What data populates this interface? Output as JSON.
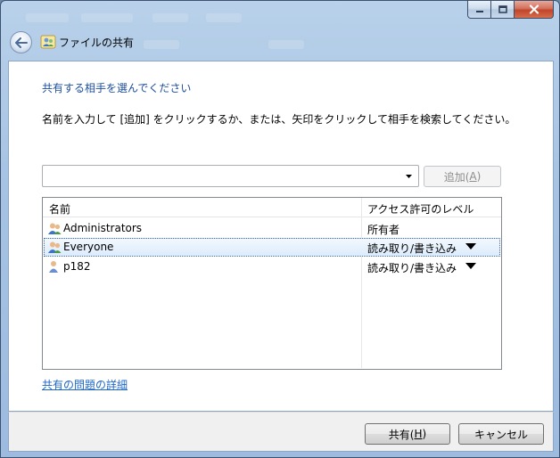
{
  "window": {
    "title": "ファイルの共有"
  },
  "dialog": {
    "heading": "共有する相手を選んでください",
    "instruction": "名前を入力して [追加] をクリックするか、または、矢印をクリックして相手を検索してください。",
    "name_input": {
      "value": "",
      "placeholder": ""
    },
    "add_button": {
      "label_before": "追加(",
      "accel": "A",
      "label_after": ")",
      "enabled": false
    }
  },
  "table": {
    "columns": {
      "name": "名前",
      "level": "アクセス許可のレベル"
    },
    "rows": [
      {
        "name": "Administrators",
        "level": "所有者",
        "icon": "group-icon",
        "has_dropdown": false,
        "selected": false
      },
      {
        "name": "Everyone",
        "level": "読み取り/書き込み",
        "icon": "group-icon",
        "has_dropdown": true,
        "selected": true
      },
      {
        "name": "p182",
        "level": "読み取り/書き込み",
        "icon": "user-icon",
        "has_dropdown": true,
        "selected": false
      }
    ]
  },
  "links": {
    "sharing_problems": "共有の問題の詳細"
  },
  "footer": {
    "share": {
      "label_before": "共有(",
      "accel": "H",
      "label_after": ")"
    },
    "cancel": {
      "label": "キャンセル"
    }
  },
  "colors": {
    "heading": "#1e4f9c",
    "link": "#1e66c4",
    "close": "#c1442a"
  }
}
